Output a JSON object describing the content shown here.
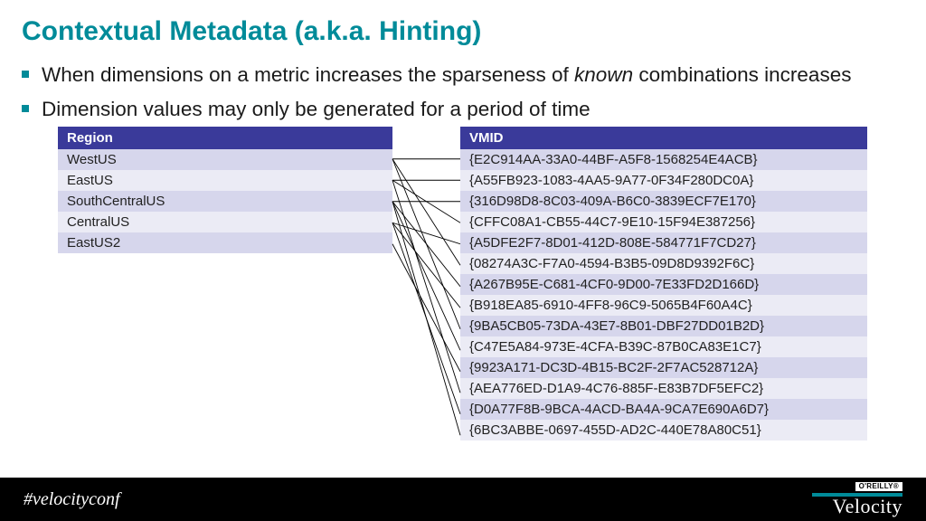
{
  "title": "Contextual Metadata (a.k.a. Hinting)",
  "bullets": [
    {
      "pre": "When dimensions on a metric increases the sparseness of ",
      "em": "known",
      "post": " combinations increases"
    },
    {
      "pre": "Dimension values may only be generated for a period of time",
      "em": "",
      "post": ""
    }
  ],
  "region_header": "Region",
  "regions": [
    "WestUS",
    "EastUS",
    "SouthCentralUS",
    "CentralUS",
    "EastUS2"
  ],
  "vmid_header": "VMID",
  "vmids": [
    "{E2C914AA-33A0-44BF-A5F8-1568254E4ACB}",
    "{A55FB923-1083-4AA5-9A77-0F34F280DC0A}",
    "{316D98D8-8C03-409A-B6C0-3839ECF7E170}",
    "{CFFC08A1-CB55-44C7-9E10-15F94E387256}",
    "{A5DFE2F7-8D01-412D-808E-584771F7CD27}",
    "{08274A3C-F7A0-4594-B3B5-09D8D9392F6C}",
    "{A267B95E-C681-4CF0-9D00-7E33FD2D166D}",
    "{B918EA85-6910-4FF8-96C9-5065B4F60A4C}",
    "{9BA5CB05-73DA-43E7-8B01-DBF27DD01B2D}",
    "{C47E5A84-973E-4CFA-B39C-87B0CA83E1C7}",
    "{9923A171-DC3D-4B15-BC2F-2F7AC528712A}",
    "{AEA776ED-D1A9-4C76-885F-E83B7DF5EFC2}",
    "{D0A77F8B-9BCA-4ACD-BA4A-9CA7E690A6D7}",
    "{6BC3ABBE-0697-455D-AD2C-440E78A80C51}"
  ],
  "connections": [
    [
      0,
      0
    ],
    [
      0,
      5
    ],
    [
      0,
      8
    ],
    [
      1,
      1
    ],
    [
      1,
      3
    ],
    [
      1,
      11
    ],
    [
      2,
      2
    ],
    [
      2,
      6
    ],
    [
      2,
      9
    ],
    [
      2,
      13
    ],
    [
      3,
      4
    ],
    [
      3,
      7
    ],
    [
      3,
      12
    ],
    [
      4,
      10
    ]
  ],
  "footer": {
    "hashtag": "#velocityconf",
    "oreilly": "O'REILLY®",
    "brand": "Velocity"
  }
}
